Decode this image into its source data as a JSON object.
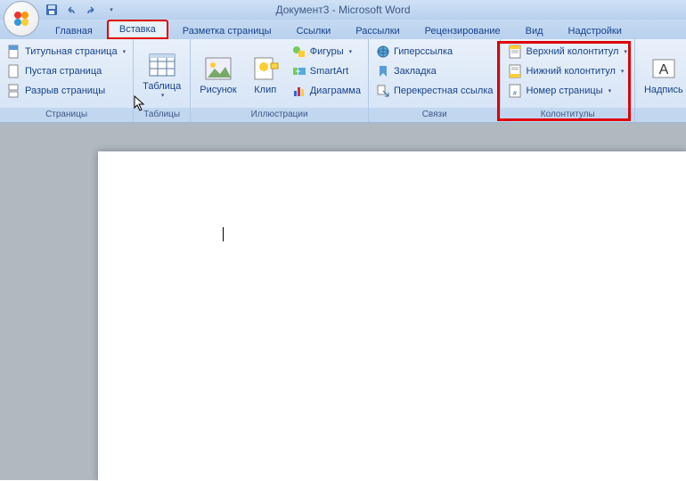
{
  "title": "Документ3 - Microsoft Word",
  "tabs": {
    "home": "Главная",
    "insert": "Вставка",
    "layout": "Разметка страницы",
    "refs": "Ссылки",
    "mail": "Рассылки",
    "review": "Рецензирование",
    "view": "Вид",
    "addins": "Надстройки"
  },
  "groups": {
    "pages": {
      "label": "Страницы",
      "cover": "Титульная страница",
      "blank": "Пустая страница",
      "break": "Разрыв страницы"
    },
    "tables": {
      "label": "Таблицы",
      "table": "Таблица"
    },
    "illus": {
      "label": "Иллюстрации",
      "picture": "Рисунок",
      "clip": "Клип",
      "shapes": "Фигуры",
      "smartart": "SmartArt",
      "chart": "Диаграмма"
    },
    "links": {
      "label": "Связи",
      "hyper": "Гиперссылка",
      "bookmark": "Закладка",
      "crossref": "Перекрестная ссылка"
    },
    "hf": {
      "label": "Колонтитулы",
      "header": "Верхний колонтитул",
      "footer": "Нижний колонтитул",
      "pagenum": "Номер страницы"
    },
    "text": {
      "label": "",
      "wordart": "Надпись"
    }
  }
}
